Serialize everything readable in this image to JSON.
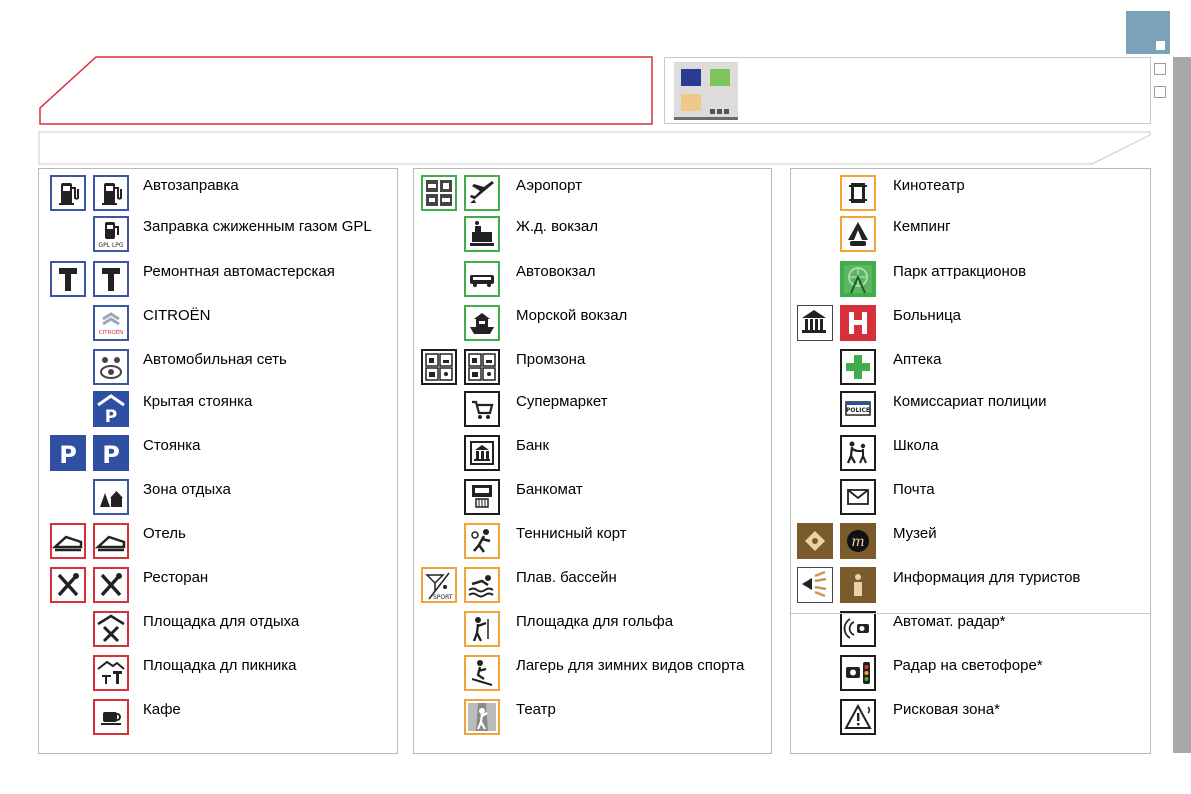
{
  "header": {
    "title": "",
    "info": "",
    "subtitle": ""
  },
  "colors": {
    "blue": "#3d55a5",
    "red": "#d6303a",
    "green": "#3fae4a",
    "orange": "#f2a33a",
    "black": "#1c1c1c",
    "brown": "#7b5a2b",
    "corner_accent": "#7aa2b8"
  },
  "columns": [
    {
      "items": [
        {
          "label": "Автозаправка",
          "icons": [
            "fuel-pump-icon",
            "fuel-pump-icon"
          ],
          "color": "blue"
        },
        {
          "label": "Заправка сжиженным газом GPL",
          "icons": [
            "lpg-fuel-icon"
          ],
          "color": "blue"
        },
        {
          "label": "Ремонтная автомастерская",
          "icons": [
            "repair-hammer-icon",
            "repair-hammer-icon"
          ],
          "color": "blue"
        },
        {
          "label": "CITROËN",
          "icons": [
            "citroen-logo-icon"
          ],
          "color": "blue"
        },
        {
          "label": "Автомобильная сеть",
          "icons": [
            "car-network-icon"
          ],
          "color": "blue"
        },
        {
          "label": "Крытая стоянка",
          "icons": [
            "covered-parking-icon"
          ],
          "color": "blue"
        },
        {
          "label": "Стоянка",
          "icons": [
            "parking-icon",
            "parking-icon"
          ],
          "color": "blue"
        },
        {
          "label": "Зона отдыха",
          "icons": [
            "rest-area-icon"
          ],
          "color": "blue"
        },
        {
          "label": "Отель",
          "icons": [
            "hotel-bed-icon",
            "hotel-bed-icon"
          ],
          "color": "red"
        },
        {
          "label": "Ресторан",
          "icons": [
            "restaurant-icon",
            "restaurant-icon"
          ],
          "color": "red"
        },
        {
          "label": "Площадка для отдыха",
          "icons": [
            "roadside-rest-icon"
          ],
          "color": "red"
        },
        {
          "label": "Площадка дл пикника",
          "icons": [
            "picnic-icon"
          ],
          "color": "red"
        },
        {
          "label": "Кафе",
          "icons": [
            "coffee-cup-icon"
          ],
          "color": "red"
        }
      ]
    },
    {
      "items": [
        {
          "label": "Аэропорт",
          "icons": [
            "transport-hub-icon",
            "airplane-icon"
          ],
          "color": "green"
        },
        {
          "label": "Ж.д. вокзал",
          "icons": [
            "train-station-icon"
          ],
          "color": "green"
        },
        {
          "label": "Автовокзал",
          "icons": [
            "bus-station-icon"
          ],
          "color": "green"
        },
        {
          "label": "Морской вокзал",
          "icons": [
            "ferry-terminal-icon"
          ],
          "color": "green"
        },
        {
          "label": "Промзона",
          "icons": [
            "industrial-zone-icon",
            "industrial-zone-icon"
          ],
          "color": "black"
        },
        {
          "label": "Супермаркет",
          "icons": [
            "shopping-cart-icon"
          ],
          "color": "black"
        },
        {
          "label": "Банк",
          "icons": [
            "bank-icon"
          ],
          "color": "black"
        },
        {
          "label": "Банкомат",
          "icons": [
            "atm-icon"
          ],
          "color": "black"
        },
        {
          "label": "Теннисный корт",
          "icons": [
            "tennis-icon"
          ],
          "color": "orange"
        },
        {
          "label": "Плав. бассейн",
          "icons": [
            "sport-leisure-icon",
            "swimming-icon"
          ],
          "color": "orange"
        },
        {
          "label": "Площадка для гольфа",
          "icons": [
            "golf-icon"
          ],
          "color": "orange"
        },
        {
          "label": "Лагерь для зимних видов спорта",
          "icons": [
            "skiing-icon"
          ],
          "color": "orange"
        },
        {
          "label": "Театр",
          "icons": [
            "theatre-icon"
          ],
          "color": "orange"
        }
      ]
    },
    {
      "items": [
        {
          "label": "Кинотеатр",
          "icons": [
            "cinema-icon"
          ],
          "color": "orange"
        },
        {
          "label": "Кемпинг",
          "icons": [
            "camping-icon"
          ],
          "color": "orange"
        },
        {
          "label": "Парк аттракционов",
          "icons": [
            "amusement-park-icon"
          ],
          "color": "green"
        },
        {
          "label": "Больница",
          "icons": [
            "public-building-icon",
            "hospital-icon"
          ],
          "color": "red"
        },
        {
          "label": "Аптека",
          "icons": [
            "pharmacy-cross-icon"
          ],
          "color": "black"
        },
        {
          "label": "Комиссариат полиции",
          "icons": [
            "police-icon"
          ],
          "color": "black"
        },
        {
          "label": "Школа",
          "icons": [
            "school-icon"
          ],
          "color": "black"
        },
        {
          "label": "Почта",
          "icons": [
            "post-office-icon"
          ],
          "color": "black"
        },
        {
          "label": "Музей",
          "icons": [
            "monument-icon",
            "museum-icon"
          ],
          "color": "brown"
        },
        {
          "label": "Информация для туристов",
          "icons": [
            "info-point-icon",
            "tourist-info-icon"
          ],
          "color": "black"
        },
        {
          "label": "Автомат. радар*",
          "icons": [
            "speed-camera-icon"
          ],
          "color": "black"
        },
        {
          "label": "Радар на светофоре*",
          "icons": [
            "traffic-light-camera-icon"
          ],
          "color": "black"
        },
        {
          "label": "Рисковая зона*",
          "icons": [
            "risk-zone-icon"
          ],
          "color": "black"
        }
      ]
    }
  ]
}
